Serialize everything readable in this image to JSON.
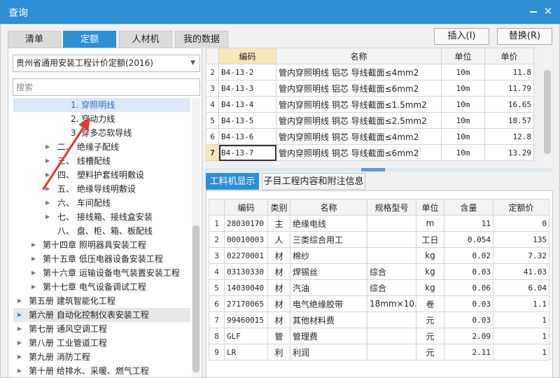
{
  "window": {
    "title": "查询"
  },
  "tabs": [
    "清单",
    "定额",
    "人材机",
    "我的数据"
  ],
  "buttons": {
    "insert": "插入(I)",
    "replace": "替换(R)"
  },
  "quota_select": "贵州省通用安装工程计价定额(2016)",
  "search": {
    "placeholder": "搜索",
    "value": ""
  },
  "tree": [
    {
      "text": "1.  穿照明线"
    },
    {
      "text": "2.  穿动力线"
    },
    {
      "text": "3.  穿多芯软导线"
    },
    {
      "text": "二、  绝缘子配线"
    },
    {
      "text": "三、  线槽配线"
    },
    {
      "text": "四、  塑料护套线明敷设"
    },
    {
      "text": "五、  绝缘导线明敷设"
    },
    {
      "text": "六、  车间配线"
    },
    {
      "text": "七、  接线箱、接线盒安装"
    },
    {
      "text": "八、  盘、柜、箱、板配线"
    },
    {
      "text": "第十四章 照明器具安装工程"
    },
    {
      "text": "第十五章 低压电器设备安装工程"
    },
    {
      "text": "第十六章 运输设备电气装置安装工程"
    },
    {
      "text": "第十七章 电气设备调试工程"
    },
    {
      "text": "第五册 建筑智能化工程"
    },
    {
      "text": "第六册 自动化控制仪表安装工程"
    },
    {
      "text": "第七册 通风空调工程"
    },
    {
      "text": "第八册 工业管道工程"
    },
    {
      "text": "第九册 消防工程"
    },
    {
      "text": "第十册 给排水、采暖、燃气工程"
    }
  ],
  "upper_grid": {
    "headers": [
      "编码",
      "名称",
      "单位",
      "单价"
    ],
    "rows": [
      {
        "n": "2",
        "code": "B4-13-2",
        "name": "管内穿照明线 铝芯 导线截面≤4mm2",
        "unit": "10m",
        "price": "11.8"
      },
      {
        "n": "3",
        "code": "B4-13-3",
        "name": "管内穿照明线 铝芯 导线截面≤6mm2",
        "unit": "10m",
        "price": "11.79"
      },
      {
        "n": "4",
        "code": "B4-13-4",
        "name": "管内穿照明线 铜芯 导线截面≤1.5mm2",
        "unit": "10m",
        "price": "16.65"
      },
      {
        "n": "5",
        "code": "B4-13-5",
        "name": "管内穿照明线 铜芯 导线截面≤2.5mm2",
        "unit": "10m",
        "price": "18.57"
      },
      {
        "n": "6",
        "code": "B4-13-6",
        "name": "管内穿照明线 铜芯 导线截面≤4mm2",
        "unit": "10m",
        "price": "12.8"
      },
      {
        "n": "7",
        "code": "B4-13-7",
        "name": "管内穿照明线 铜芯 导线截面≤6mm2",
        "unit": "10m",
        "price": "13.29"
      }
    ]
  },
  "sub_tabs": [
    "工料机显示",
    "子目工程内容和附注信息"
  ],
  "lower_grid": {
    "headers": [
      "编码",
      "类别",
      "名称",
      "规格型号",
      "单位",
      "含量",
      "定额价"
    ],
    "rows": [
      {
        "n": "1",
        "code": "28030170",
        "type": "主",
        "name": "绝缘电线",
        "spec": "",
        "unit": "m",
        "qty": "11",
        "price": "0"
      },
      {
        "n": "2",
        "code": "00010003",
        "type": "人",
        "name": "三类综合用工",
        "spec": "",
        "unit": "工日",
        "qty": "0.054",
        "price": "135"
      },
      {
        "n": "3",
        "code": "02270001",
        "type": "材",
        "name": "棉纱",
        "spec": "",
        "unit": "kg",
        "qty": "0.02",
        "price": "7.32"
      },
      {
        "n": "4",
        "code": "03130330",
        "type": "材",
        "name": "焊锡丝",
        "spec": "综合",
        "unit": "kg",
        "qty": "0.03",
        "price": "41.03"
      },
      {
        "n": "5",
        "code": "14030040",
        "type": "材",
        "name": "汽油",
        "spec": "综合",
        "unit": "kg",
        "qty": "0.06",
        "price": "6.04"
      },
      {
        "n": "6",
        "code": "27170065",
        "type": "材",
        "name": "电气绝缘胶带",
        "spec": "18mm×10…",
        "unit": "卷",
        "qty": "0.03",
        "price": "1.1"
      },
      {
        "n": "7",
        "code": "99460015",
        "type": "材",
        "name": "其他材料费",
        "spec": "",
        "unit": "元",
        "qty": "0.03",
        "price": "1"
      },
      {
        "n": "8",
        "code": "GLF",
        "type": "管",
        "name": "管理费",
        "spec": "",
        "unit": "元",
        "qty": "2.09",
        "price": "1"
      },
      {
        "n": "9",
        "code": "LR",
        "type": "利",
        "name": "利润",
        "spec": "",
        "unit": "元",
        "qty": "2.11",
        "price": "1"
      }
    ]
  },
  "colors": {
    "accent": "#2d8fd5",
    "selected_row": "#dbe9f8",
    "header_highlight": "#fbe6b8",
    "annotation_arrow": "#e03a2e"
  }
}
